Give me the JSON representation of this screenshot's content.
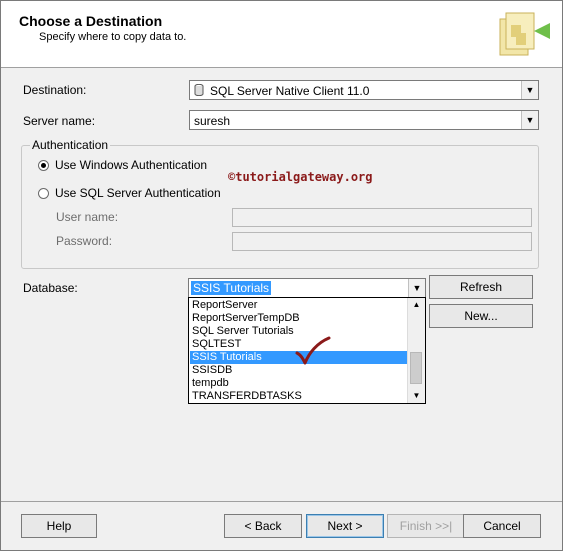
{
  "header": {
    "title": "Choose a Destination",
    "subtitle": "Specify where to copy data to."
  },
  "destination": {
    "label": "Destination:",
    "value": "SQL Server Native Client 11.0"
  },
  "server": {
    "label": "Server name:",
    "value": "suresh"
  },
  "authentication": {
    "legend": "Authentication",
    "windows_label": "Use Windows Authentication",
    "sql_label": "Use SQL Server Authentication",
    "username_label": "User name:",
    "password_label": "Password:",
    "selected": "windows"
  },
  "watermark": "©tutorialgateway.org",
  "database": {
    "label": "Database:",
    "value": "SSIS Tutorials",
    "refresh_label": "Refresh",
    "new_label": "New...",
    "options": [
      "ReportServer",
      "ReportServerTempDB",
      "SQL Server Tutorials",
      "SQLTEST",
      "SSIS Tutorials",
      "SSISDB",
      "tempdb",
      "TRANSFERDBTASKS"
    ],
    "selected_index": 4
  },
  "footer": {
    "help_label": "Help",
    "back_label": "< Back",
    "next_label": "Next >",
    "finish_label": "Finish >>|",
    "cancel_label": "Cancel"
  },
  "colors": {
    "selection": "#3399ff",
    "checkmark": "#8b1a1a"
  }
}
